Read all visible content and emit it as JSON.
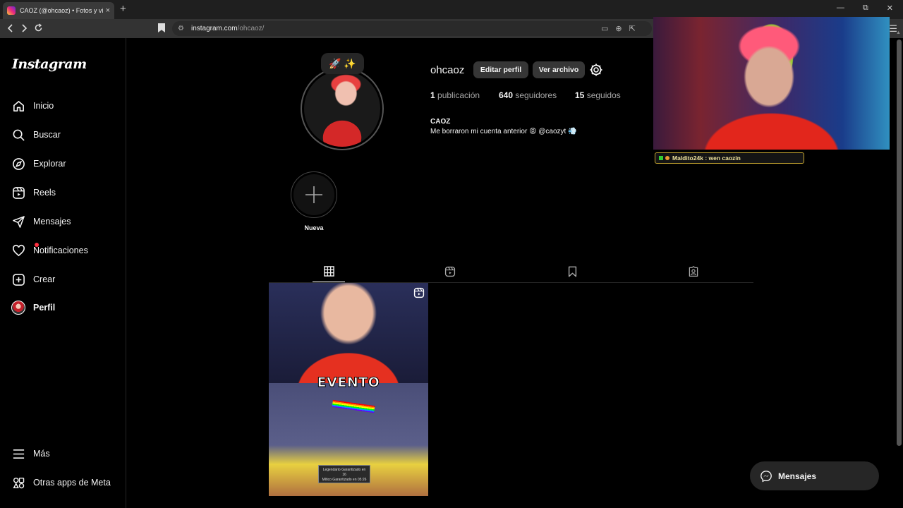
{
  "browser": {
    "tab_title": "CAOZ (@ohcaoz) • Fotos y videos",
    "tab_close": "×",
    "new_tab": "+",
    "url_host": "instagram.com",
    "url_path": "/ohcaoz/",
    "win_min": "—",
    "win_restore": "⧉",
    "win_close": "✕"
  },
  "sidebar": {
    "logo": "Instagram",
    "items": [
      {
        "label": "Inicio",
        "icon": "home-icon"
      },
      {
        "label": "Buscar",
        "icon": "search-icon"
      },
      {
        "label": "Explorar",
        "icon": "compass-icon"
      },
      {
        "label": "Reels",
        "icon": "reels-icon"
      },
      {
        "label": "Mensajes",
        "icon": "send-icon"
      },
      {
        "label": "Notificaciones",
        "icon": "heart-icon"
      },
      {
        "label": "Crear",
        "icon": "plus-square-icon"
      },
      {
        "label": "Perfil",
        "icon": "avatar"
      }
    ],
    "more_label": "Más",
    "meta_label": "Otras apps de Meta"
  },
  "profile": {
    "note": "🚀 ✨",
    "username": "ohcaoz",
    "edit_button": "Editar perfil",
    "archive_button": "Ver archivo",
    "posts_count": "1",
    "posts_label": "publicación",
    "followers_count": "640",
    "followers_label": "seguidores",
    "following_count": "15",
    "following_label": "seguidos",
    "full_name": "CAOZ",
    "bio": "Me borraron mi cuenta anterior 😡 @caozyt 💨",
    "highlight_label": "Nueva"
  },
  "post": {
    "overlay_text": "EVENTO",
    "sign_text": "Legendario Garantizado en 16\nMítico Garantizado en 05:26"
  },
  "stream": {
    "chat_user": "Maldito24k",
    "chat_text": ": wen caozin"
  },
  "messages_pill": {
    "label": "Mensajes"
  },
  "colors": {
    "background": "#000000",
    "button_bg": "#363636",
    "notification_dot": "#ff3040",
    "chat_border": "#c8a830"
  }
}
